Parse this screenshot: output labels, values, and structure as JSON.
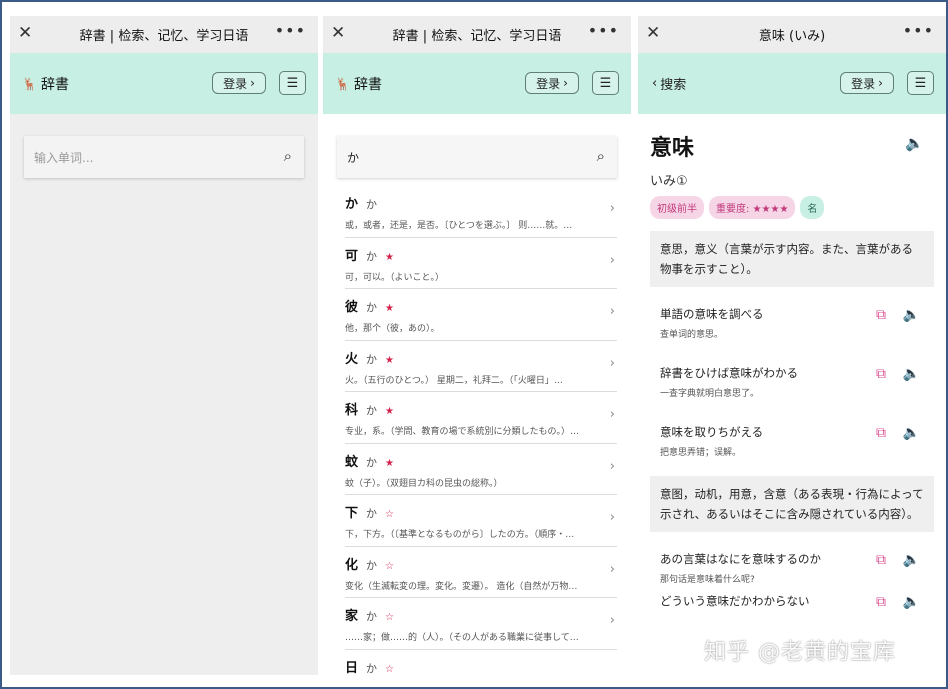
{
  "wx": {
    "close": "✕",
    "more": "•••",
    "title_dict": "辞書 | 检索、记忆、学习日语",
    "title_detail": "意味 (いみ)"
  },
  "app": {
    "brand_icon": "deer-icon",
    "brand": "辞書",
    "back": "搜索",
    "login": "登录",
    "menu_icon": "☰"
  },
  "screen1": {
    "search_placeholder": "输入单词..."
  },
  "screen2": {
    "search_value": "か",
    "results": [
      {
        "kanji": "か",
        "kana": "か",
        "star": "",
        "desc": "或，或者，还是，是否。〔ひとつを選ぶ。〕 则……就。…"
      },
      {
        "kanji": "可",
        "kana": "か",
        "star": "★",
        "desc": "可，可以。（よいこと。）"
      },
      {
        "kanji": "彼",
        "kana": "か",
        "star": "★",
        "desc": "他，那个（彼，あの）。"
      },
      {
        "kanji": "火",
        "kana": "か",
        "star": "★",
        "desc": "火。（五行のひとつ。） 星期二，礼拜二。（「火曜日」…"
      },
      {
        "kanji": "科",
        "kana": "か",
        "star": "★",
        "desc": "专业，系。（学問、教育の場で系統別に分類したもの。）…"
      },
      {
        "kanji": "蚊",
        "kana": "か",
        "star": "★",
        "desc": "蚊（子）。（双翅目カ科の昆虫の総称。）"
      },
      {
        "kanji": "下",
        "kana": "か",
        "star": "☆",
        "desc": "下，下方。（〔基準となるものがら〕したの方。（順序・…"
      },
      {
        "kanji": "化",
        "kana": "か",
        "star": "☆",
        "desc": "变化（生滅転変の理。変化。変遷）。 造化（自然が万物…"
      },
      {
        "kanji": "家",
        "kana": "か",
        "star": "☆",
        "desc": "……家；做……的（人）。（その人がある職業に従事して…"
      },
      {
        "kanji": "日",
        "kana": "か",
        "star": "☆",
        "desc": ""
      }
    ]
  },
  "screen3": {
    "word": "意味",
    "reading": "いみ①",
    "tags": [
      "初级前半",
      "重要度: ★★★★",
      "名"
    ],
    "meaning1": "意思，意义（言葉が示す内容。また、言葉がある物事を示すこと）。",
    "examples1": [
      {
        "jp": "単語の意味を調べる",
        "cn": "查单词的意思。"
      },
      {
        "jp": "辞書をひけば意味がわかる",
        "cn": "一查字典就明白意思了。"
      },
      {
        "jp": "意味を取りちがえる",
        "cn": "把意思弄错；误解。"
      }
    ],
    "meaning2": "意图，动机，用意，含意（ある表現・行為によって示され、あるいはそこに含み隠されている内容）。",
    "examples2": [
      {
        "jp": "あの言葉はなにを意味するのか",
        "cn": "那句话是意味着什么呢?"
      },
      {
        "jp": "どういう意味だかわからない",
        "cn": ""
      }
    ]
  },
  "watermark": "知乎 @老黄的宝库"
}
